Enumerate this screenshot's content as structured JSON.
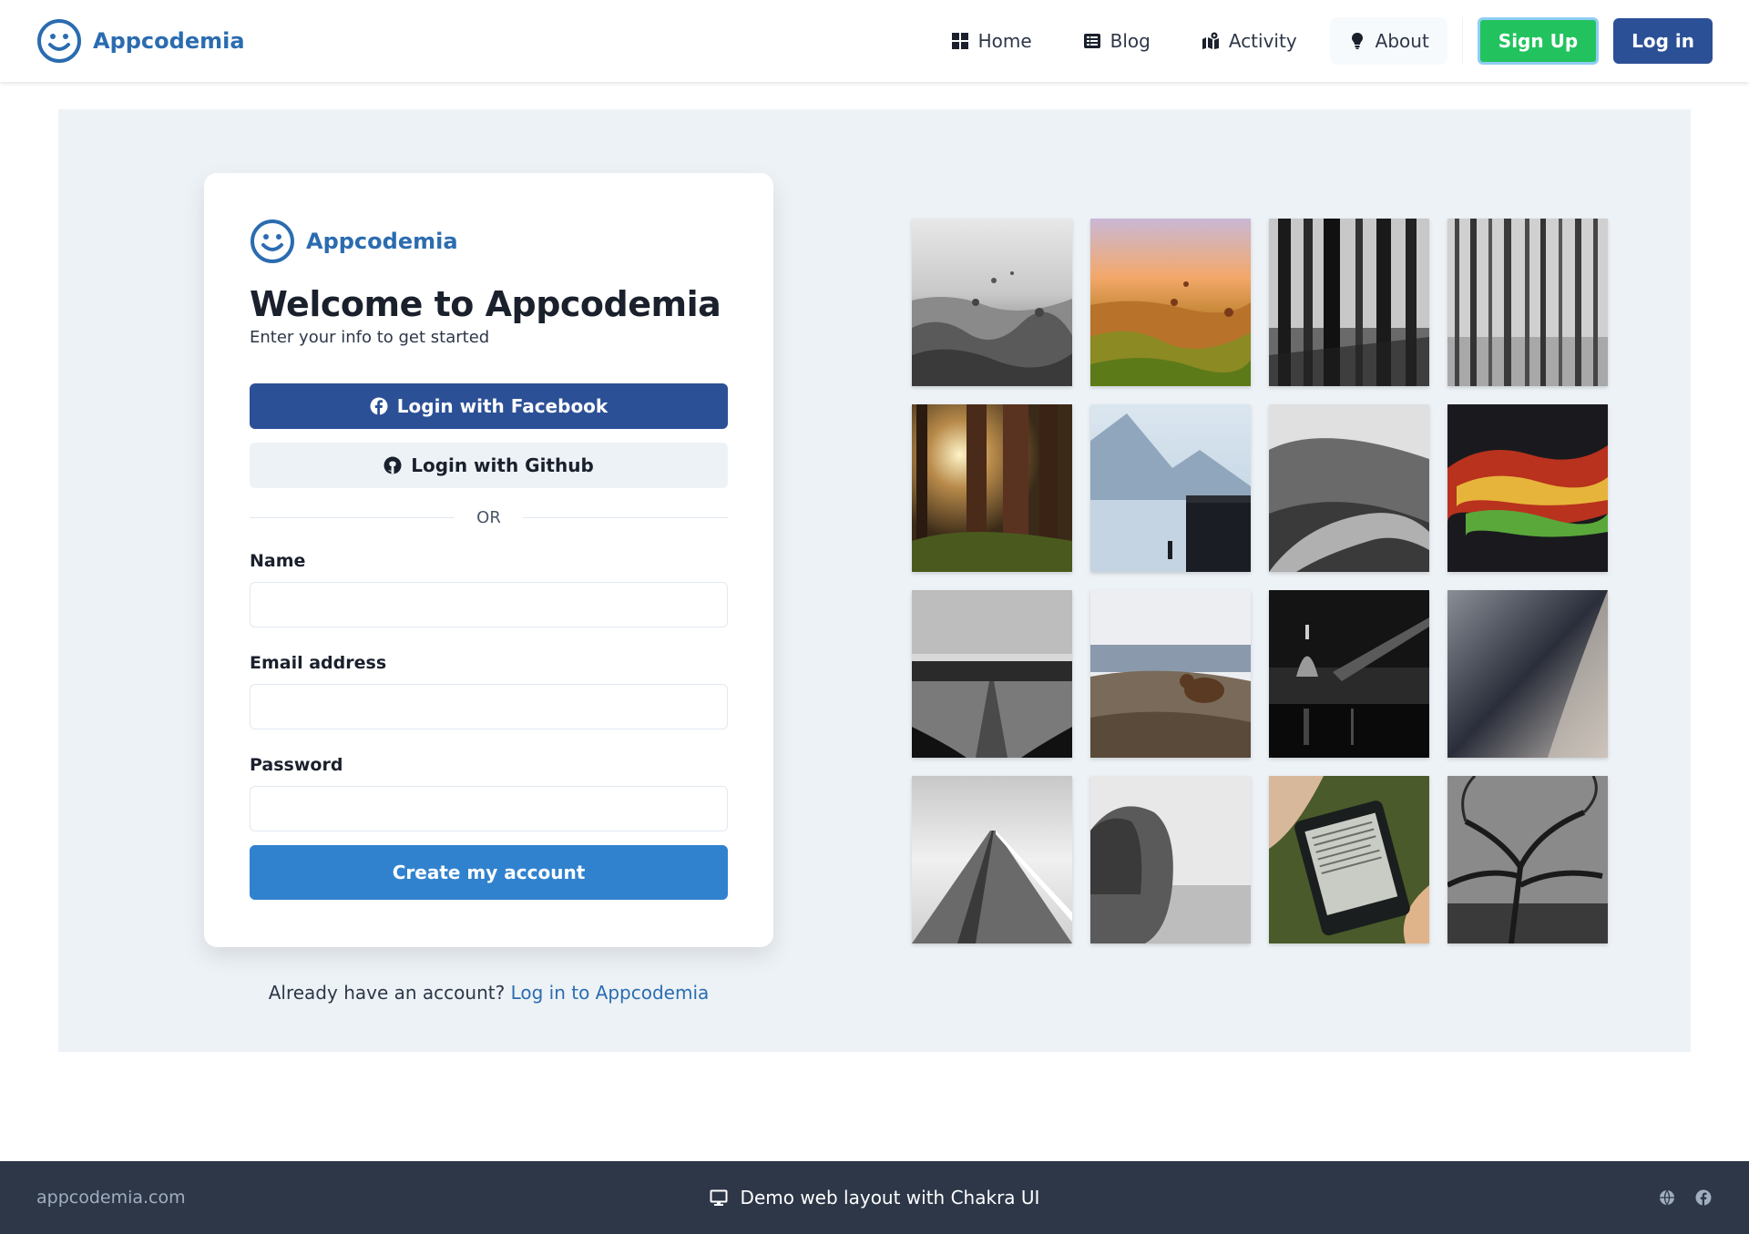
{
  "brand": {
    "name": "Appcodemia",
    "color": "#2b6cb0"
  },
  "nav": {
    "items": [
      {
        "label": "Home",
        "icon": "grid-icon"
      },
      {
        "label": "Blog",
        "icon": "list-icon"
      },
      {
        "label": "Activity",
        "icon": "map-icon"
      },
      {
        "label": "About",
        "icon": "lightbulb-icon"
      }
    ],
    "signup_label": "Sign Up",
    "login_label": "Log in"
  },
  "card": {
    "brand_name": "Appcodemia",
    "title": "Welcome to Appcodemia",
    "subtitle": "Enter your info to get started",
    "facebook_label": "Login with Facebook",
    "github_label": "Login with Github",
    "or_text": "OR",
    "fields": [
      {
        "label": "Name",
        "value": ""
      },
      {
        "label": "Email address",
        "value": ""
      },
      {
        "label": "Password",
        "value": ""
      }
    ],
    "submit_label": "Create my account"
  },
  "already": {
    "prompt": "Already have an account?",
    "link": "Log in to Appcodemia"
  },
  "gallery": {
    "photos": [
      "cappadocia-balloons-bw-photo",
      "cappadocia-balloons-sunset-photo",
      "dark-forest-bw-photo",
      "pine-forest-bw-photo",
      "sunlit-forest-photo",
      "misty-lake-pier-photo",
      "mountain-road-bw-photo",
      "red-abstract-photo",
      "cypress-field-bw-photo",
      "bear-on-hill-photo",
      "city-night-bridge-bw-photo",
      "wet-surface-photo",
      "long-pier-bw-photo",
      "woman-field-bw-photo",
      "ereader-hand-photo",
      "gnarled-tree-bw-photo"
    ]
  },
  "footer": {
    "domain": "appcodemia.com",
    "center_text": "Demo web layout with Chakra UI",
    "icons": [
      "globe-icon",
      "facebook-icon"
    ]
  },
  "colors": {
    "signup": "#22c35e",
    "login": "#2c5096",
    "primary": "#3182ce",
    "panel_bg": "#edf2f6",
    "footer_bg": "#2d3748"
  }
}
